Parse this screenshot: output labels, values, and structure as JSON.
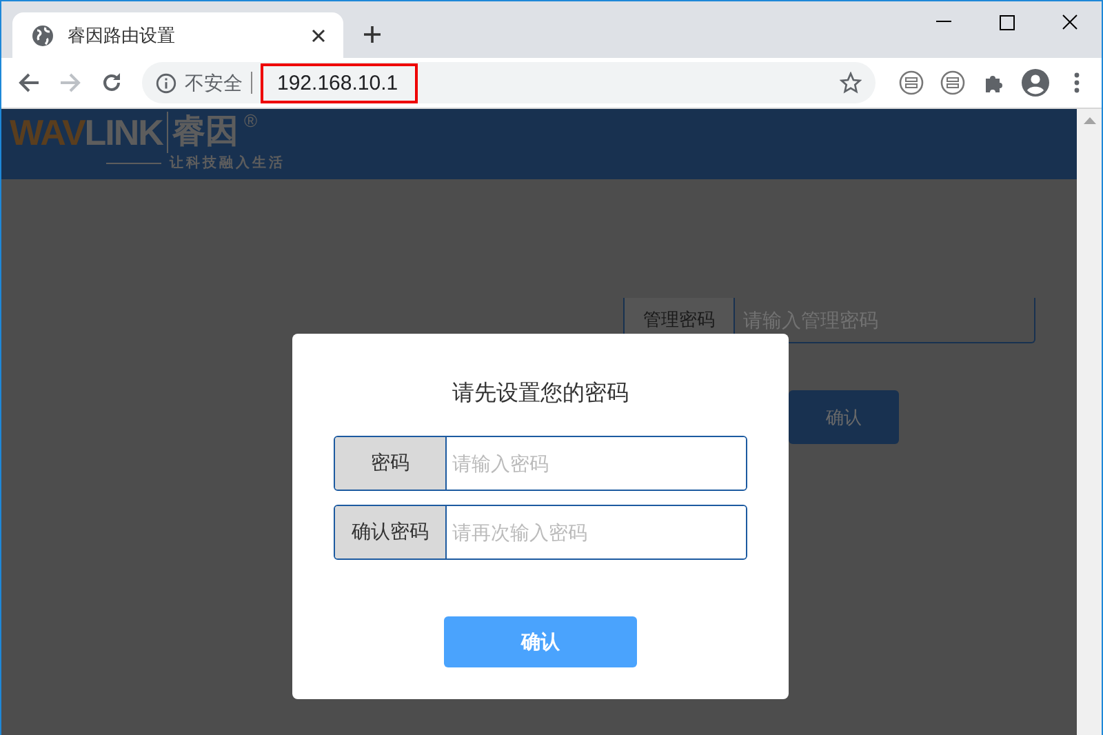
{
  "tab": {
    "title": "睿因路由设置",
    "selected": true
  },
  "address_bar": {
    "security_label": "不安全",
    "url": "192.168.10.1",
    "highlighted": true
  },
  "logo": {
    "brand_a": "WAV",
    "brand_b": "LINK",
    "name": "睿因",
    "mark": "®",
    "slogan": "让科技融入生活"
  },
  "login_form": {
    "label": "管理密码",
    "placeholder": "请输入管理密码",
    "button": "确认"
  },
  "dialog": {
    "title": "请先设置您的密码",
    "fields": [
      {
        "label": "密码",
        "placeholder": "请输入密码"
      },
      {
        "label": "确认密码",
        "placeholder": "请再次输入密码"
      }
    ],
    "button": "确认"
  }
}
